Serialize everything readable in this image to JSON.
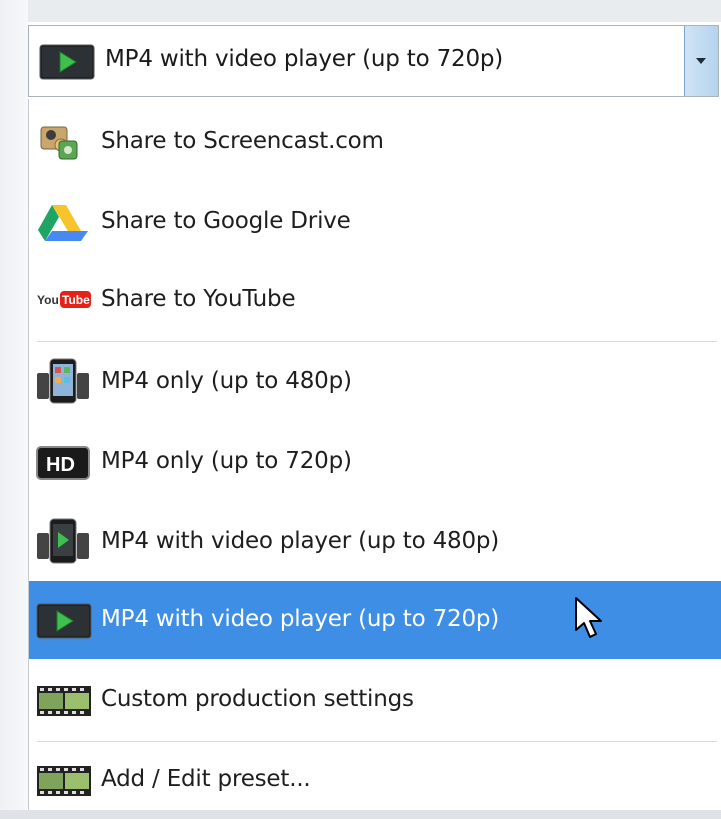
{
  "combobox": {
    "selected_label": "MP4 with video player (up to 720p)",
    "selected_icon": "play-video-icon"
  },
  "menu": {
    "items": [
      {
        "label": "Share to Screencast.com",
        "icon": "screencast-icon"
      },
      {
        "label": "Share to Google Drive",
        "icon": "google-drive-icon"
      },
      {
        "label": "Share to YouTube",
        "icon": "youtube-icon"
      },
      {
        "label": "MP4 only (up to 480p)",
        "icon": "phone-device-icon"
      },
      {
        "label": "MP4 only (up to 720p)",
        "icon": "hd-icon"
      },
      {
        "label": "MP4 with video player (up to 480p)",
        "icon": "phone-player-icon"
      },
      {
        "label": "MP4 with video player (up to 720p)",
        "icon": "play-video-icon",
        "selected": true
      },
      {
        "label": "Custom production settings",
        "icon": "film-strip-icon"
      },
      {
        "label": "Add / Edit preset...",
        "icon": "film-strip-icon"
      }
    ],
    "youtube_logo_text": "You",
    "youtube_logo_tube": "Tube",
    "hd_text": "HD"
  },
  "colors": {
    "selection": "#3d8ee4",
    "play_green": "#38b54a",
    "youtube_red": "#e62117"
  }
}
